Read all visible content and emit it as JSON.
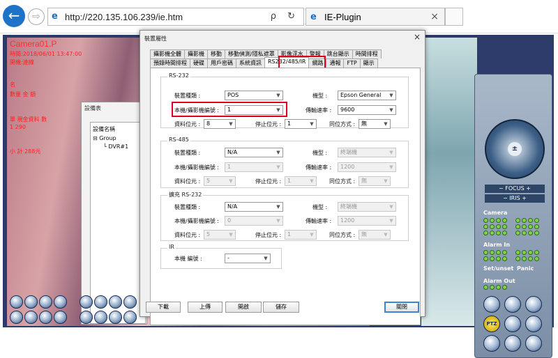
{
  "browser": {
    "url": "http://220.135.106.239/ie.htm",
    "tab_title": "IE-Plugin",
    "back_icon": "←",
    "forward_icon": "⇨",
    "search_icon": "ρ",
    "refresh_icon": "↻",
    "close_icon": "×"
  },
  "video": {
    "camera_title": "Camera01.P",
    "osd_lines": [
      "時間:2018/06/01 13:47:00",
      "開機:連線",
      "名",
      "數量 金 額",
      "",
      "單 現金資料 數",
      "1 290",
      "小 計 288元"
    ]
  },
  "device_list": {
    "title": "設備表",
    "column_header": "設備名稱",
    "group_label": "Group",
    "device_label": "DVR#1"
  },
  "ptz": {
    "focus_label": "FOCUS",
    "iris_label": "IRIS",
    "camera_label": "Camera",
    "alarm_in_label": "Alarm In",
    "set_unset_label": "Set/unset",
    "panic_label": "Panic",
    "alarm_out_label": "Alarm Out",
    "ptz_button_label": "PTZ",
    "minus": "−",
    "plus": "+"
  },
  "dialog": {
    "title": "裝置屬性",
    "close": "×",
    "tabs_row1": [
      "攝影機全體",
      "攝影機",
      "移動",
      "移動偵測/隱私遮罩",
      "影像浮水",
      "警報",
      "跳台顯示",
      "時間排程"
    ],
    "tabs_row2": [
      "預錄時間排程",
      "硬碟",
      "用戶密碼",
      "系統資訊",
      "RS232/485/IR",
      "網路",
      "通報",
      "FTP",
      "顯示"
    ],
    "active_tab": "RS232/485/IR",
    "rs232": {
      "title": "RS-232",
      "device_type_label": "裝置種類 :",
      "device_type_value": "POS",
      "model_label": "機型 :",
      "model_value": "Epson General",
      "camera_no_label": "本機/攝影機編號 :",
      "camera_no_value": "1",
      "baud_label": "傳輸速率 :",
      "baud_value": "9600",
      "data_bits_label": "資料位元 :",
      "data_bits_value": "8",
      "stop_bits_label": "停止位元 :",
      "stop_bits_value": "1",
      "parity_label": "同位方式 :",
      "parity_value": "無"
    },
    "rs485": {
      "title": "RS-485",
      "device_type_label": "裝置種類 :",
      "device_type_value": "N/A",
      "model_label": "機型 :",
      "model_value": "終端機",
      "camera_no_label": "本機/攝影機編號 :",
      "camera_no_value": "1",
      "baud_label": "傳輸速率 :",
      "baud_value": "1200",
      "data_bits_label": "資料位元 :",
      "data_bits_value": "5",
      "stop_bits_label": "停止位元 :",
      "stop_bits_value": "1",
      "parity_label": "同位方式 :",
      "parity_value": "無"
    },
    "ext_rs232": {
      "title": "擴充 RS-232",
      "device_type_label": "裝置種類 :",
      "device_type_value": "N/A",
      "model_label": "機型 :",
      "model_value": "終端機",
      "camera_no_label": "本機/攝影機編號 :",
      "camera_no_value": "0",
      "baud_label": "傳輸速率 :",
      "baud_value": "1200",
      "data_bits_label": "資料位元 :",
      "data_bits_value": "5",
      "stop_bits_label": "停止位元 :",
      "stop_bits_value": "1",
      "parity_label": "同位方式 :",
      "parity_value": "無"
    },
    "ir": {
      "title": "IR",
      "label": "本機 編號 :",
      "value": "-"
    },
    "buttons": {
      "download": "下載",
      "upload": "上傳",
      "open": "開啟",
      "save": "儲存",
      "close": "關閉"
    },
    "dropdown_arrow": "▼"
  }
}
